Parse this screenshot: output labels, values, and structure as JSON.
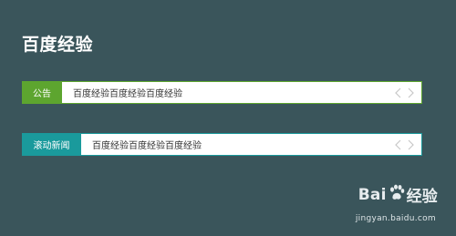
{
  "page": {
    "title": "百度经验"
  },
  "tickers": [
    {
      "label": "公告",
      "label_color": "#5da52f",
      "text": "百度经验百度经验百度经验",
      "border_color": "#5da52f"
    },
    {
      "label": "滚动新闻",
      "label_color": "#1a9a9c",
      "text": "百度经验百度经验百度经验",
      "border_color": "#1a9a9c"
    }
  ],
  "nav_icons": {
    "prev": "chevron-left-icon",
    "next": "chevron-right-icon"
  },
  "watermark": {
    "brand_left": "Bai",
    "brand_right": "经验",
    "url": "jingyan.baidu.com"
  },
  "colors": {
    "background": "#3a555b",
    "nav_icon": "#c8c8c8"
  }
}
